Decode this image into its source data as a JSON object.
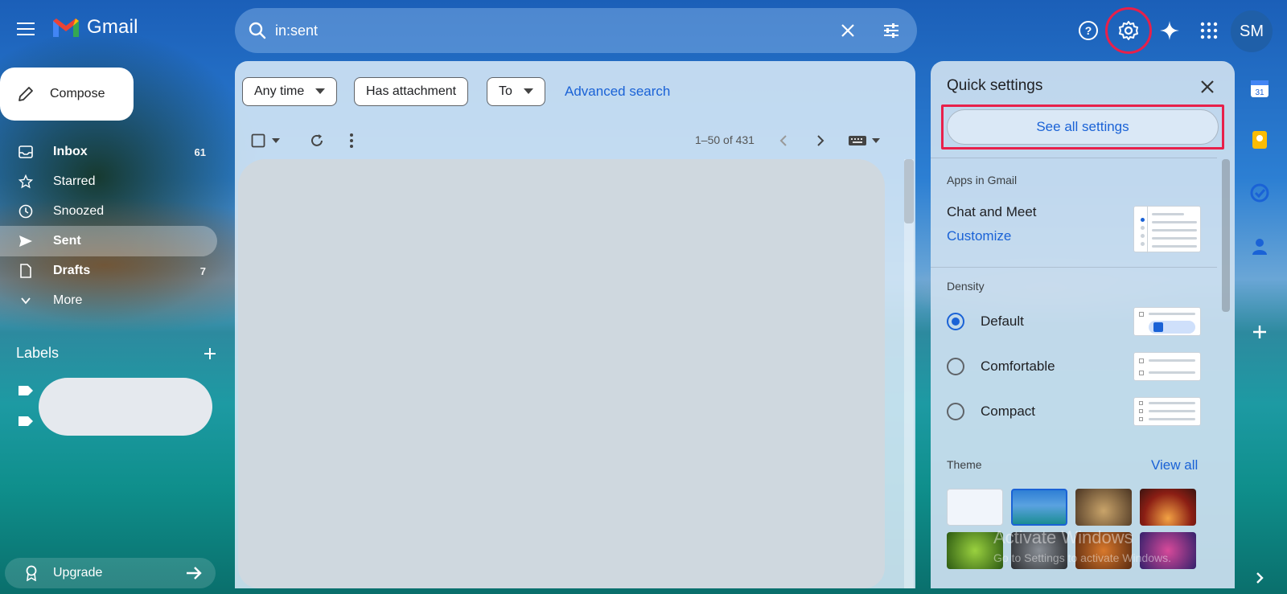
{
  "app": {
    "name": "Gmail"
  },
  "search": {
    "value": "in:sent"
  },
  "user": {
    "initials": "SM"
  },
  "sidebar": {
    "compose_label": "Compose",
    "items": [
      {
        "label": "Inbox",
        "count": "61"
      },
      {
        "label": "Starred",
        "count": ""
      },
      {
        "label": "Snoozed",
        "count": ""
      },
      {
        "label": "Sent",
        "count": ""
      },
      {
        "label": "Drafts",
        "count": "7"
      },
      {
        "label": "More",
        "count": ""
      }
    ],
    "labels_heading": "Labels",
    "upgrade_label": "Upgrade"
  },
  "filters": {
    "any_time": "Any time",
    "has_attachment": "Has attachment",
    "to": "To",
    "advanced_search": "Advanced search"
  },
  "pager": {
    "text": "1–50 of 431"
  },
  "quick_settings": {
    "title": "Quick settings",
    "see_all": "See all settings",
    "apps_heading": "Apps in Gmail",
    "chat_meet": "Chat and Meet",
    "customize": "Customize",
    "density_heading": "Density",
    "density_options": [
      "Default",
      "Comfortable",
      "Compact"
    ],
    "density_selected": "Default",
    "theme_heading": "Theme",
    "view_all": "View all"
  },
  "watermark": {
    "line1": "Activate Windows",
    "line2": "Go to Settings to activate Windows."
  },
  "colors": {
    "accent": "#1a62d6",
    "highlight": "#e8204a"
  }
}
